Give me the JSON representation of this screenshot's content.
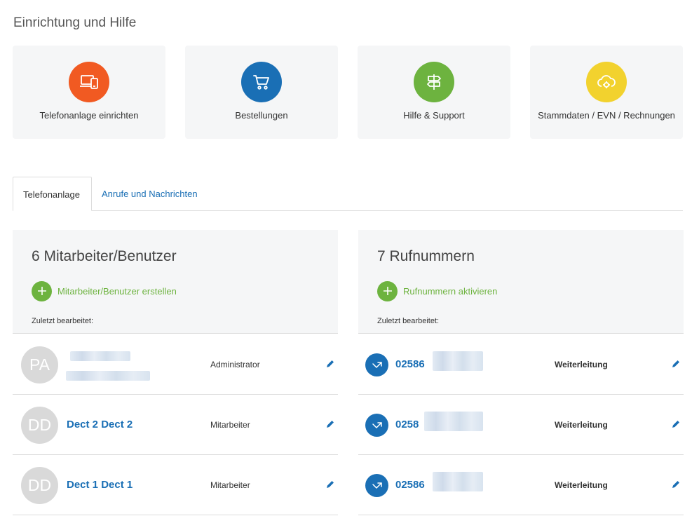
{
  "section": {
    "title": "Einrichtung und Hilfe"
  },
  "tiles": [
    {
      "label": "Telefonanlage einrichten",
      "icon": "devices-icon",
      "color": "#f15a22"
    },
    {
      "label": "Bestellungen",
      "icon": "shopping-cart-icon",
      "color": "#1a6fb5"
    },
    {
      "label": "Hilfe & Support",
      "icon": "signpost-icon",
      "color": "#6db33f"
    },
    {
      "label": "Stammdaten / EVN / Rechnungen",
      "icon": "cloud-gear-icon",
      "color": "#f2d22e"
    }
  ],
  "tabs": [
    {
      "label": "Telefonanlage",
      "active": true
    },
    {
      "label": "Anrufe und Nachrichten",
      "active": false
    }
  ],
  "users_panel": {
    "title": "6 Mitarbeiter/Benutzer",
    "add_label": "Mitarbeiter/Benutzer erstellen",
    "last_edited": "Zuletzt bearbeitet:",
    "rows": [
      {
        "initials": "PA",
        "name": "",
        "role": "Administrator"
      },
      {
        "initials": "DD",
        "name": "Dect 2 Dect 2",
        "role": "Mitarbeiter"
      },
      {
        "initials": "DD",
        "name": "Dect 1 Dect 1",
        "role": "Mitarbeiter"
      }
    ]
  },
  "numbers_panel": {
    "title": "7 Rufnummern",
    "add_label": "Rufnummern aktivieren",
    "last_edited": "Zuletzt bearbeitet:",
    "rows": [
      {
        "number": "02586",
        "type": "Weiterleitung"
      },
      {
        "number": "0258",
        "type": "Weiterleitung"
      },
      {
        "number": "02586",
        "type": "Weiterleitung"
      }
    ]
  },
  "colors": {
    "accent_blue": "#1a6fb5",
    "accent_green": "#6db33f",
    "tile_bg": "#f5f6f7"
  }
}
